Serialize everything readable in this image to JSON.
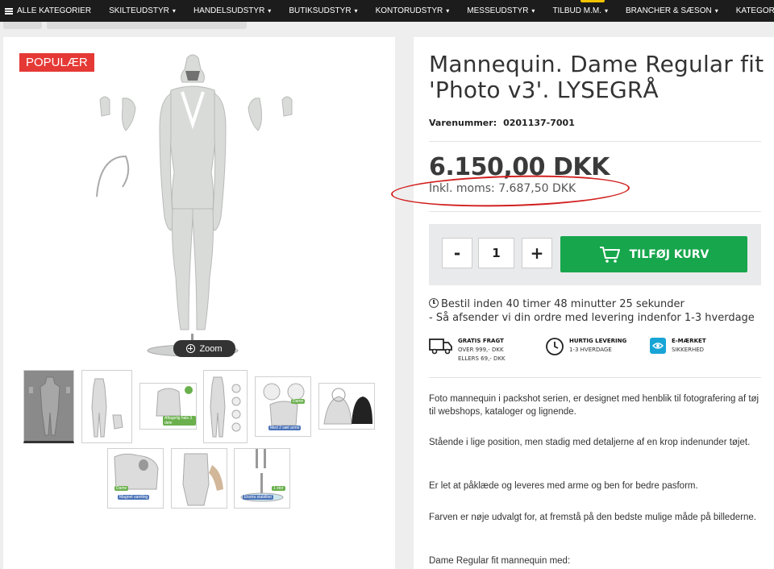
{
  "nav": {
    "items": [
      {
        "label": "ALLE KATEGORIER"
      },
      {
        "label": "SKILTEUDSTYR"
      },
      {
        "label": "HANDELSUDSTYR"
      },
      {
        "label": "BUTIKSUDSTYR"
      },
      {
        "label": "KONTORUDSTYR"
      },
      {
        "label": "MESSEUDSTYR"
      },
      {
        "label": "TILBUD M.M."
      },
      {
        "label": "BRANCHER & SÆSON"
      },
      {
        "label": "KATEGORIOVERSIGT"
      }
    ]
  },
  "gallery": {
    "badge": "POPULÆR",
    "zoom_label": "Zoom",
    "thumb_tags": {
      "t3": "Aftagelig hals 3 dele",
      "t5": "Med 2 sæt arme",
      "t7": "Magnet samling",
      "t9": "Ekstra stabilitet",
      "t5b": "Dame",
      "t7b": "Dame",
      "t9b": "1 stor"
    }
  },
  "product": {
    "title": "Mannequin. Dame Regular fit 'Photo v3'. LYSEGRÅ",
    "sku_label": "Varenummer:",
    "sku_value": "0201137-7001",
    "price": "6.150,00 DKK",
    "price_incl": "Inkl. moms: 7.687,50 DKK",
    "qty_minus": "-",
    "qty_value": "1",
    "qty_plus": "+",
    "add_to_cart": "TILFØJ KURV",
    "delivery_line1": "Bestil inden 40 timer 48 minutter 25 sekunder",
    "delivery_line2": "- Så afsender vi din ordre med levering indenfor 1-3 hverdage",
    "features": [
      {
        "title": "GRATIS FRAGT",
        "line1": "OVER 999,- DKK",
        "line2": "ELLERS 69,- DKK",
        "icon": "truck-icon"
      },
      {
        "title": "HURTIG LEVERING",
        "line1": "1-3 HVERDAGE",
        "line2": "",
        "icon": "clock-icon"
      },
      {
        "title": "E-MÆRKET",
        "line1": "SIKKERHED",
        "line2": "",
        "icon": "e-maerket-icon"
      }
    ],
    "description": [
      "Foto mannequin i packshot serien, er designet med henblik til fotografering af tøj til webshops, kataloger og lignende.",
      "Stående i lige position, men stadig med detaljerne af en krop indenunder tøjet.",
      "Er let at påklæde og leveres med arme og ben for bedre pasform.",
      "Farven er nøje udvalgt for, at fremstå på den bedste mulige måde på billederne.",
      "Dame Regular fit mannequin med:"
    ]
  },
  "colors": {
    "accent_green": "#17a64c",
    "badge_red": "#e53935",
    "annotation_red": "#d21f1f",
    "nav_bg": "#1c1c1c"
  }
}
